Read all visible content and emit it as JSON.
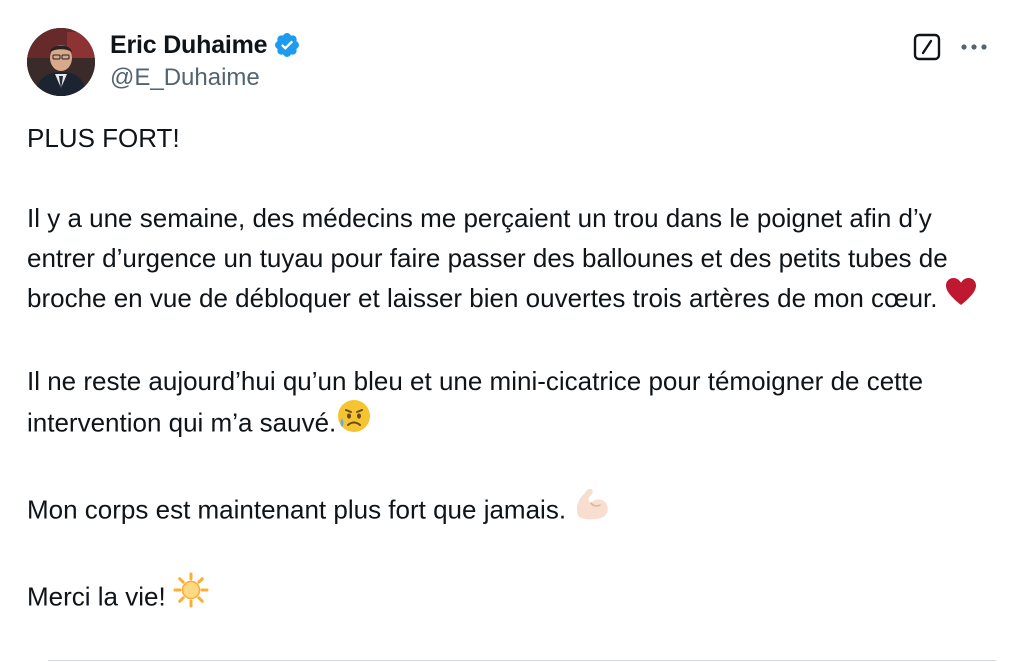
{
  "author": {
    "display_name": "Eric Duhaime",
    "handle": "@E_Duhaime",
    "verified": true
  },
  "icons": {
    "verified": "verified-badge-icon",
    "grok": "grok-icon",
    "more": "more-options-icon",
    "heart": "red-heart-emoji",
    "sad": "sad-but-relieved-face-emoji",
    "flex": "flexed-biceps-light-skin-emoji",
    "sun": "sun-emoji"
  },
  "colors": {
    "verified_blue": "#1d9bf0",
    "text_primary": "#0f1419",
    "text_secondary": "#536471"
  },
  "tweet": {
    "p1": "PLUS FORT!",
    "p2": "Il y a une semaine, des médecins me perçaient un trou dans le poignet afin d’y entrer d’urgence un tuyau pour faire passer des ballounes et des petits tubes de broche en vue de débloquer et laisser bien ouvertes trois artères de mon cœur. ",
    "p3": "Il ne reste aujourd’hui qu’un bleu et une mini-cicatrice pour témoigner de cette intervention qui m’a sauvé.",
    "p4": "Mon corps est maintenant plus fort que jamais. ",
    "p5": "Merci la vie! "
  }
}
